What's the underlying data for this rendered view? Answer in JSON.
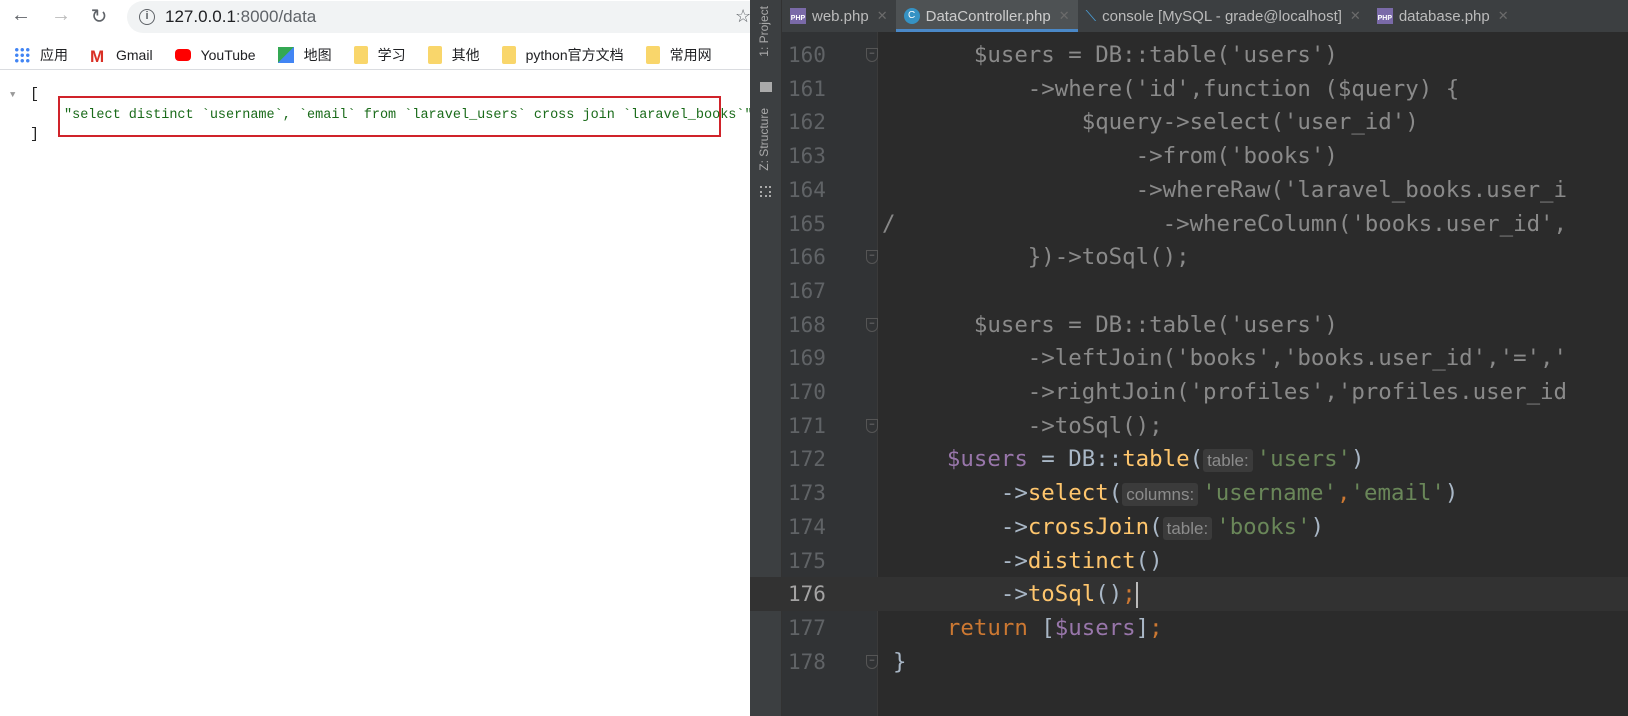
{
  "browser": {
    "url_host": "127.0.0.1",
    "url_path": ":8000/data",
    "bookmarks": [
      {
        "label": "应用",
        "icon": "apps-grid-icon"
      },
      {
        "label": "Gmail",
        "icon": "gmail-icon"
      },
      {
        "label": "YouTube",
        "icon": "youtube-icon"
      },
      {
        "label": "地图",
        "icon": "maps-icon"
      },
      {
        "label": "学习",
        "icon": "folder-icon"
      },
      {
        "label": "其他",
        "icon": "folder-icon"
      },
      {
        "label": "python官方文档",
        "icon": "folder-icon"
      },
      {
        "label": "常用网",
        "icon": "folder-icon"
      }
    ],
    "json_open": "[",
    "json_close": "]",
    "json_value": "\"select distinct `username`, `email` from `laravel_users` cross join `laravel_books`\""
  },
  "ide": {
    "side_tabs": [
      "1: Project",
      "Z: Structure"
    ],
    "tabs": [
      {
        "label": "web.php",
        "icon": "php-file-icon",
        "active": false
      },
      {
        "label": "DataController.php",
        "icon": "class-file-icon",
        "active": true
      },
      {
        "label": "console [MySQL - grade@localhost]",
        "icon": "console-icon",
        "active": false
      },
      {
        "label": "database.php",
        "icon": "php-file-icon",
        "active": false
      }
    ],
    "current_line": 176,
    "lines": [
      {
        "n": 160,
        "fold": true,
        "t": [
          [
            "      $users = DB::table('users')",
            "cm"
          ]
        ]
      },
      {
        "n": 161,
        "t": [
          [
            "          ->where('id',function ($query) {",
            "cm"
          ]
        ]
      },
      {
        "n": 162,
        "t": [
          [
            "              $query->select('user_id')",
            "cm"
          ]
        ]
      },
      {
        "n": 163,
        "t": [
          [
            "                  ->from('books')",
            "cm"
          ]
        ]
      },
      {
        "n": 164,
        "t": [
          [
            "                  ->whereRaw('laravel_books.user_i",
            "cm"
          ]
        ]
      },
      {
        "n": 165,
        "mark": "/",
        "t": [
          [
            "                    ->whereColumn('books.user_id',",
            "cm"
          ]
        ]
      },
      {
        "n": 166,
        "fold": true,
        "t": [
          [
            "          })->toSql();",
            "cm"
          ]
        ]
      },
      {
        "n": 167,
        "t": []
      },
      {
        "n": 168,
        "fold": true,
        "t": [
          [
            "      $users = DB::table('users')",
            "cm"
          ]
        ]
      },
      {
        "n": 169,
        "t": [
          [
            "          ->leftJoin('books','books.user_id','=','",
            "cm"
          ]
        ]
      },
      {
        "n": 170,
        "t": [
          [
            "          ->rightJoin('profiles','profiles.user_id",
            "cm"
          ]
        ]
      },
      {
        "n": 171,
        "fold": true,
        "t": [
          [
            "          ->toSql();",
            "cm"
          ]
        ]
      },
      {
        "n": 172,
        "t": [
          [
            "    ",
            "p"
          ],
          [
            "$users",
            "var"
          ],
          [
            " = DB::",
            "p"
          ],
          [
            "table",
            "fn"
          ],
          [
            "(",
            "p"
          ],
          [
            "table:",
            "hint"
          ],
          [
            "'users'",
            "s"
          ],
          [
            ")",
            "p"
          ]
        ]
      },
      {
        "n": 173,
        "t": [
          [
            "        ->",
            "p"
          ],
          [
            "select",
            "fn"
          ],
          [
            "(",
            "p"
          ],
          [
            "columns:",
            "hint"
          ],
          [
            "'username'",
            "s"
          ],
          [
            ",",
            "kw"
          ],
          [
            "'email'",
            "s"
          ],
          [
            ")",
            "p"
          ]
        ]
      },
      {
        "n": 174,
        "t": [
          [
            "        ->",
            "p"
          ],
          [
            "crossJoin",
            "fn"
          ],
          [
            "(",
            "p"
          ],
          [
            "table:",
            "hint"
          ],
          [
            "'books'",
            "s"
          ],
          [
            ")",
            "p"
          ]
        ]
      },
      {
        "n": 175,
        "t": [
          [
            "        ->",
            "p"
          ],
          [
            "distinct",
            "fn"
          ],
          [
            "()",
            "p"
          ]
        ]
      },
      {
        "n": 176,
        "t": [
          [
            "        ->",
            "p"
          ],
          [
            "toSql",
            "fn"
          ],
          [
            "()",
            "p"
          ],
          [
            ";",
            "kw"
          ]
        ],
        "caret": true
      },
      {
        "n": 177,
        "t": [
          [
            "    ",
            "p"
          ],
          [
            "return",
            "kw"
          ],
          [
            " [",
            "p"
          ],
          [
            "$users",
            "var"
          ],
          [
            "]",
            "p"
          ],
          [
            ";",
            "kw"
          ]
        ]
      },
      {
        "n": 178,
        "fold": true,
        "t": [
          [
            "}",
            "p"
          ]
        ]
      }
    ]
  }
}
